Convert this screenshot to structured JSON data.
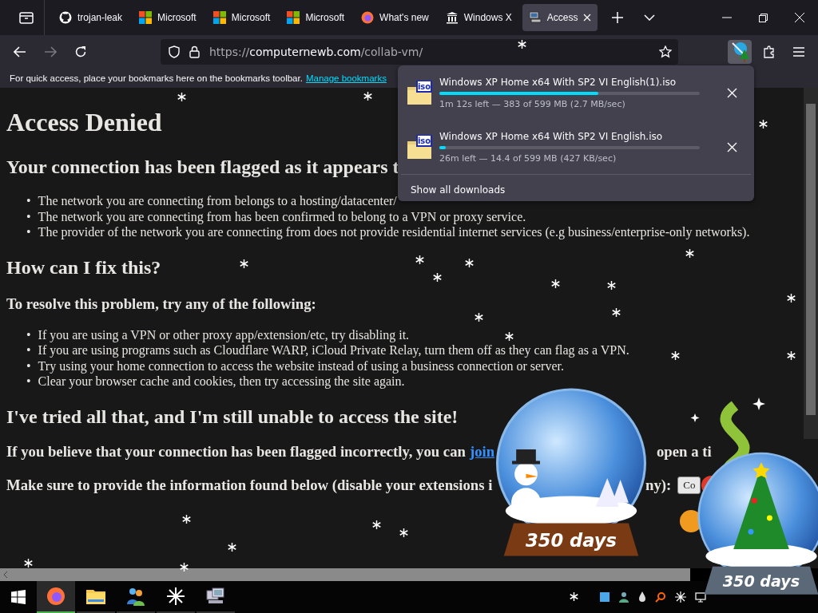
{
  "tabs": [
    {
      "label": "trojan-leak",
      "kind": "github",
      "selected": false
    },
    {
      "label": "Microsoft",
      "kind": "microsoft",
      "selected": false
    },
    {
      "label": "Microsoft",
      "kind": "microsoft",
      "selected": false
    },
    {
      "label": "Microsoft",
      "kind": "microsoft",
      "selected": false
    },
    {
      "label": "What's new",
      "kind": "firefox",
      "selected": false
    },
    {
      "label": "Windows X",
      "kind": "museum",
      "selected": false
    },
    {
      "label": "Access",
      "kind": "computer",
      "selected": true
    }
  ],
  "url": {
    "scheme": "https://",
    "domain": "computernewb.com",
    "path": "/collab-vm/"
  },
  "bookmarks_bar": {
    "text": "For quick access, place your bookmarks here on the bookmarks toolbar.",
    "link": "Manage bookmarks"
  },
  "page": {
    "title": "Access Denied",
    "bullet": "•",
    "heading_1": "Your connection has been flagged as it appears t",
    "reasons": [
      "The network you are connecting from belongs to a hosting/datacenter/",
      "The network you are connecting from has been confirmed to belong to a VPN or proxy service.",
      "The provider of the network you are connecting from does not provide residential internet services (e.g business/enterprise-only networks)."
    ],
    "heading_2": "How can I fix this?",
    "subheading": "To resolve this problem, try any of the following:",
    "fixes": [
      "If you are using a VPN or other proxy app/extension/etc, try disabling it.",
      "If you are using programs such as Cloudflare WARP, iCloud Private Relay, turn them off as they can flag as a VPN.",
      "Try using your home connection to access the website instead of using a business connection or server.",
      "Clear your browser cache and cookies, then try accessing the site again."
    ],
    "heading_3": "I've tried all that, and I'm still unable to access the site!",
    "contact": {
      "text": "If you believe that your connection has been flagged incorrectly, you can",
      "link": "join",
      "tail": "open a ti"
    },
    "info": {
      "text": "Make sure to provide the information found below (disable your extensions i",
      "tail": "ny):",
      "button": "Co"
    }
  },
  "downloads": {
    "items": [
      {
        "file": "Windows XP Home x64 With SP2 VI English(1).iso",
        "icon_label": "iso",
        "level": 0.61,
        "status": "1m 12s left — 383 of 599 MB (2.7 MB/sec)"
      },
      {
        "file": "Windows XP Home x64 With SP2 VI English.iso",
        "icon_label": "iso",
        "level": 0.024,
        "status": "26m left — 14.4 of 599 MB (427 KB/sec)"
      }
    ],
    "show_all": "Show all downloads"
  },
  "globes": [
    {
      "caption": "350 days"
    },
    {
      "caption": "350 days"
    }
  ]
}
